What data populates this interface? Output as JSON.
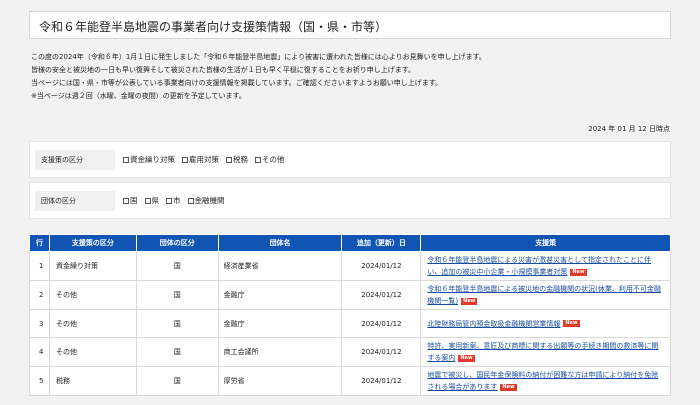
{
  "title": "令和６年能登半島地震の事業者向け支援策情報（国・県・市等）",
  "intro": [
    "この度の2024年（令和６年）1月１日に発生しました「令和６年能登半島地震」により被害に遭われた皆様には心よりお見舞いを申し上げます。",
    "皆様の安全と被災地の一日も早い復興そして被災された皆様の生活が１日も早く平穏に復することをお祈り申し上げます。",
    "当ページには国・県・市等が公表している事業者向けの支援情報を掲載しています。ご確認くださいますようお願い申し上げます。",
    "※当ページは週２回（水曜、金曜の夜間）の更新を予定しています。"
  ],
  "date": "2024 年 01 月 12 日時点",
  "filters": {
    "support": {
      "label": "支援策の区分",
      "options": [
        "資金繰り対策",
        "雇用対策",
        "税務",
        "その他"
      ]
    },
    "org": {
      "label": "団体の区分",
      "options": [
        "国",
        "県",
        "市",
        "金融機関"
      ]
    }
  },
  "table": {
    "headers": [
      "行",
      "支援策の区分",
      "団体の区分",
      "団体名",
      "追加（更新）日",
      "支援策"
    ],
    "new_badge": "New",
    "rows": [
      {
        "no": "1",
        "category": "資金繰り対策",
        "org_type": "国",
        "org": "経済産業省",
        "date": "2024/01/12",
        "support": "令和６年能登半島地震による災害が激甚災害として指定されたことに伴い、追加の被災中小企業・小規模事業者対策"
      },
      {
        "no": "2",
        "category": "その他",
        "org_type": "国",
        "org": "金融庁",
        "date": "2024/01/12",
        "support": "令和６年能登半島地震による被災地の金融機関の状況(休業、利用不可金融機関一覧)"
      },
      {
        "no": "3",
        "category": "その他",
        "org_type": "国",
        "org": "金融庁",
        "date": "2024/01/12",
        "support": "北陸財務局管内預金取扱金融機関営業情報"
      },
      {
        "no": "4",
        "category": "その他",
        "org_type": "国",
        "org": "商工会議所",
        "date": "2024/01/12",
        "support": "特許、実用新案、意匠及び商標に関する出願等の手続き期間の救済等に関する案内"
      },
      {
        "no": "5",
        "category": "税務",
        "org_type": "国",
        "org": "厚労省",
        "date": "2024/01/12",
        "support": "地震で被災し、国民年金保険料の納付が困難な方は申請により納付を免除される場合があります"
      }
    ]
  },
  "colors": {
    "header_bg": "#1155b4",
    "link": "#1a4fa0",
    "new_badge": "#e03a2c"
  }
}
